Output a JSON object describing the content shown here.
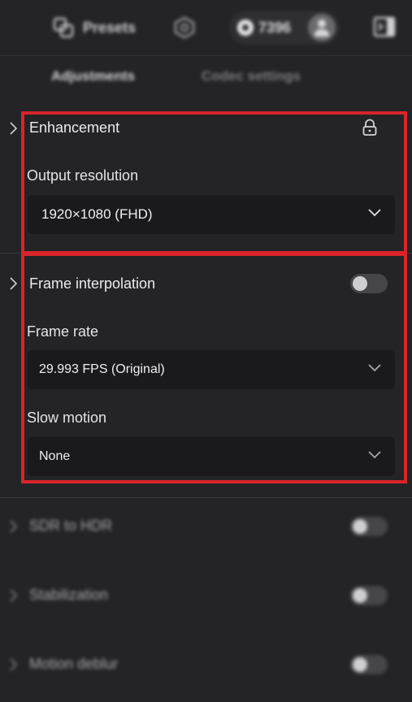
{
  "topbar": {
    "presets_label": "Presets",
    "credits": "7396"
  },
  "tabs": {
    "adjustments": "Adjustments",
    "codec_settings": "Codec settings"
  },
  "enhancement": {
    "title": "Enhancement",
    "output_resolution_label": "Output resolution",
    "output_resolution_value": "1920×1080 (FHD)"
  },
  "frame_interpolation": {
    "title": "Frame interpolation",
    "enabled": false,
    "frame_rate_label": "Frame rate",
    "frame_rate_value": "29.993 FPS (Original)",
    "slow_motion_label": "Slow motion",
    "slow_motion_value": "None"
  },
  "other_sections": [
    {
      "title": "SDR to HDR",
      "enabled": false
    },
    {
      "title": "Stabilization",
      "enabled": false
    },
    {
      "title": "Motion deblur",
      "enabled": false
    }
  ],
  "colors": {
    "background": "#242427",
    "highlight": "#d9242a"
  }
}
